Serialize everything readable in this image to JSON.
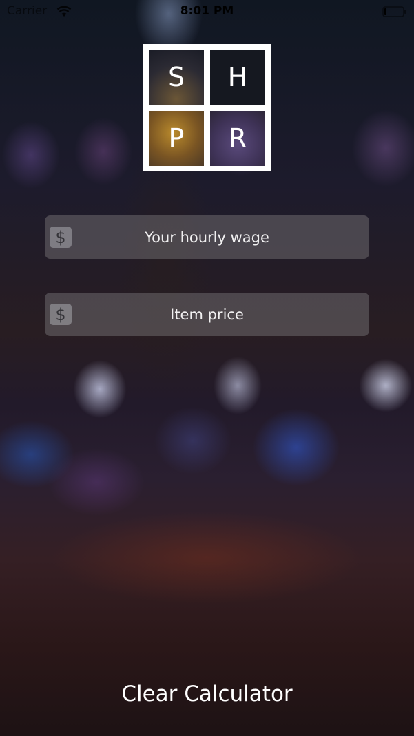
{
  "status_bar": {
    "carrier": "Carrier",
    "time": "8:01 PM",
    "icons": [
      "wifi-icon",
      "battery-icon"
    ]
  },
  "logo": {
    "letters": [
      "S",
      "H",
      "P",
      "R"
    ]
  },
  "fields": {
    "wage": {
      "placeholder": "Your hourly wage",
      "value": "",
      "icon": "$"
    },
    "price": {
      "placeholder": "Item price",
      "value": "",
      "icon": "$"
    }
  },
  "actions": {
    "clear_label": "Clear Calculator"
  },
  "colors": {
    "text": "#ffffff",
    "field_background": "#6e696e",
    "logo_frame": "#ffffff"
  }
}
